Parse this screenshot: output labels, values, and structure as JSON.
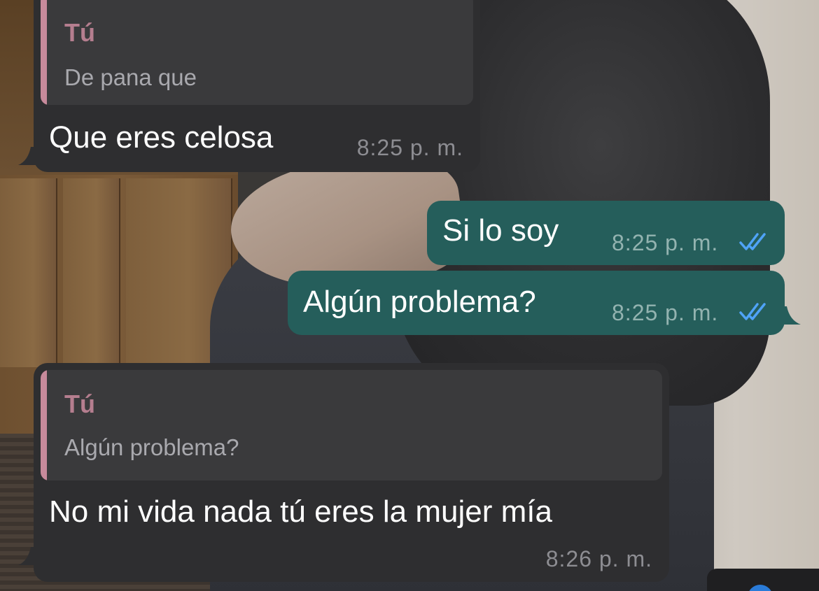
{
  "messages": [
    {
      "id": "m1",
      "direction": "incoming",
      "reply": {
        "author": "Tú",
        "text": "De pana que"
      },
      "text": "Que eres celosa",
      "time": "8:25 p. m."
    },
    {
      "id": "m2",
      "direction": "outgoing",
      "text": "Si lo soy",
      "time": "8:25 p. m.",
      "status": "read"
    },
    {
      "id": "m3",
      "direction": "outgoing",
      "text": "Algún problema?",
      "time": "8:25 p. m.",
      "status": "read"
    },
    {
      "id": "m4",
      "direction": "incoming",
      "reply": {
        "author": "Tú",
        "text": "Algún problema?"
      },
      "text": "No mi vida nada tú eres la mujer mía",
      "time": "8:26 p. m."
    }
  ],
  "colors": {
    "incoming_bubble": "#2e2e30",
    "outgoing_bubble": "#255e5b",
    "reply_accent": "#c78a9b",
    "read_ticks": "#4fa3f7"
  },
  "icons": {
    "read_receipt": "double-check-icon"
  }
}
